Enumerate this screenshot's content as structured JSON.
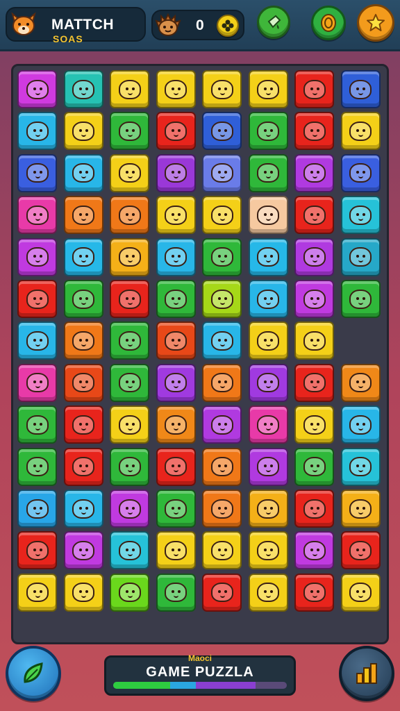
{
  "header": {
    "title": "MATTCH",
    "subtitle": "SOAS",
    "score": "0",
    "mascot_icon": "fox-face-icon",
    "buttons": [
      {
        "name": "shop-button",
        "icon": "paint-bucket-icon",
        "color": "#3fb63a"
      },
      {
        "name": "coin-button",
        "icon": "coin-icon",
        "color": "#2fb040"
      },
      {
        "name": "favorites-button",
        "icon": "star-icon",
        "color": "#f39b1c"
      }
    ]
  },
  "board": {
    "columns": 8,
    "rows": 13,
    "tiles": [
      [
        "#d03ae0",
        "#26c2b3",
        "#f4d018",
        "#f4d018",
        "#f4d018",
        "#f4d018",
        "#e8241c",
        "#2f5fd8"
      ],
      [
        "#28b6e8",
        "#f4d018",
        "#2fb83a",
        "#e8241c",
        "#2f5fd8",
        "#2fb83a",
        "#e8241c",
        "#f4d018"
      ],
      [
        "#3a5fe0",
        "#28b6e8",
        "#f4d018",
        "#9a38d8",
        "#6a7ce8",
        "#2fb83a",
        "#b03ae0",
        "#3a5fe0"
      ],
      [
        "#e83aa8",
        "#f07818",
        "#f07818",
        "#f4d018",
        "#f4d018",
        "#f6c9a0",
        "#e8241c",
        "#26c2d8"
      ],
      [
        "#c03ae0",
        "#26b8e8",
        "#f4b018",
        "#28b6e8",
        "#2fb83a",
        "#26b8e8",
        "#b03ae0",
        "#26a8c8"
      ],
      [
        "#e8241c",
        "#2fb83a",
        "#e8241c",
        "#2fb83a",
        "#a6d818",
        "#28b6e8",
        "#c03ae0",
        "#2fb83a"
      ],
      [
        "#28b6e8",
        "#f07818",
        "#2fb83a",
        "#e84818",
        "#28b6e8",
        "#f4d018",
        "#f4d018",
        null
      ],
      [
        "#e83aa8",
        "#e84818",
        "#2fb83a",
        "#a03ae0",
        "#f07818",
        "#a03ae0",
        "#e8241c",
        "#f08818"
      ],
      [
        "#2fb83a",
        "#e8241c",
        "#f4d018",
        "#f08818",
        "#b03ae0",
        "#e83aa8",
        "#f4d018",
        "#28b6e8"
      ],
      [
        "#2fb83a",
        "#e8241c",
        "#2fb83a",
        "#e8241c",
        "#f07818",
        "#b03ae0",
        "#2fb83a",
        "#26c2d8"
      ],
      [
        "#28a6e8",
        "#28b6e8",
        "#c03ae0",
        "#2fb83a",
        "#f07818",
        "#f4b018",
        "#e8241c",
        "#f4b018"
      ],
      [
        "#e8241c",
        "#c03ae0",
        "#26c2d8",
        "#f4d018",
        "#f4d018",
        "#f4d018",
        "#c03ae0",
        "#e8241c"
      ],
      [
        "#f4d018",
        "#f4d018",
        "#6ad81c",
        "#2fb83a",
        "#e8241c",
        "#f4d018",
        "#e8241c",
        "#f4d018"
      ]
    ]
  },
  "footer": {
    "small_label": "Maoci",
    "title": "GAME PUZZLA",
    "left_button_icon": "leaf-icon",
    "right_button_icon": "stats-bars-icon",
    "progress": 0.82
  }
}
